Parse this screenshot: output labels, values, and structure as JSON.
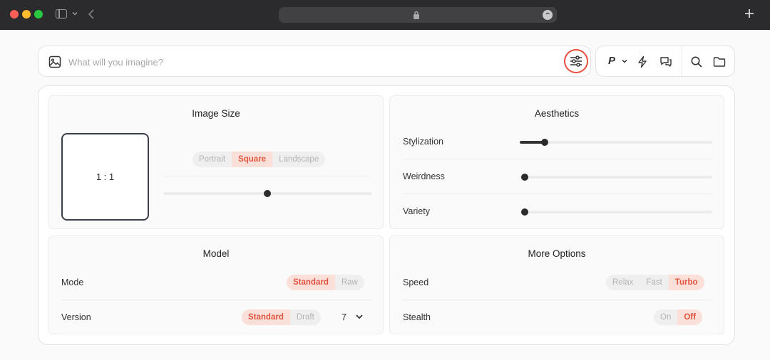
{
  "prompt": {
    "placeholder": "What will you imagine?"
  },
  "toolbar": {
    "profile_letter": "P"
  },
  "image_size": {
    "title": "Image Size",
    "ratio": "1 : 1",
    "orientation_options": [
      "Portrait",
      "Square",
      "Landscape"
    ],
    "selected": "Square",
    "slider_value": 0.5
  },
  "aesthetics": {
    "title": "Aesthetics",
    "sliders": [
      {
        "label": "Stylization",
        "value": 0.13
      },
      {
        "label": "Weirdness",
        "value": 0.0
      },
      {
        "label": "Variety",
        "value": 0.0
      }
    ]
  },
  "model": {
    "title": "Model",
    "mode_label": "Mode",
    "mode_options": [
      "Standard",
      "Raw"
    ],
    "mode_selected": "Standard",
    "version_label": "Version",
    "version_options": [
      "Standard",
      "Draft"
    ],
    "version_selected": "Standard",
    "version_number": "7"
  },
  "more_options": {
    "title": "More Options",
    "speed_label": "Speed",
    "speed_options": [
      "Relax",
      "Fast",
      "Turbo"
    ],
    "speed_selected": "Turbo",
    "stealth_label": "Stealth",
    "stealth_options": [
      "On",
      "Off"
    ],
    "stealth_selected": "Off"
  },
  "colors": {
    "accent": "#e2543f",
    "accent_bg": "#fbe0da",
    "highlight_ring": "#e94e3b"
  }
}
